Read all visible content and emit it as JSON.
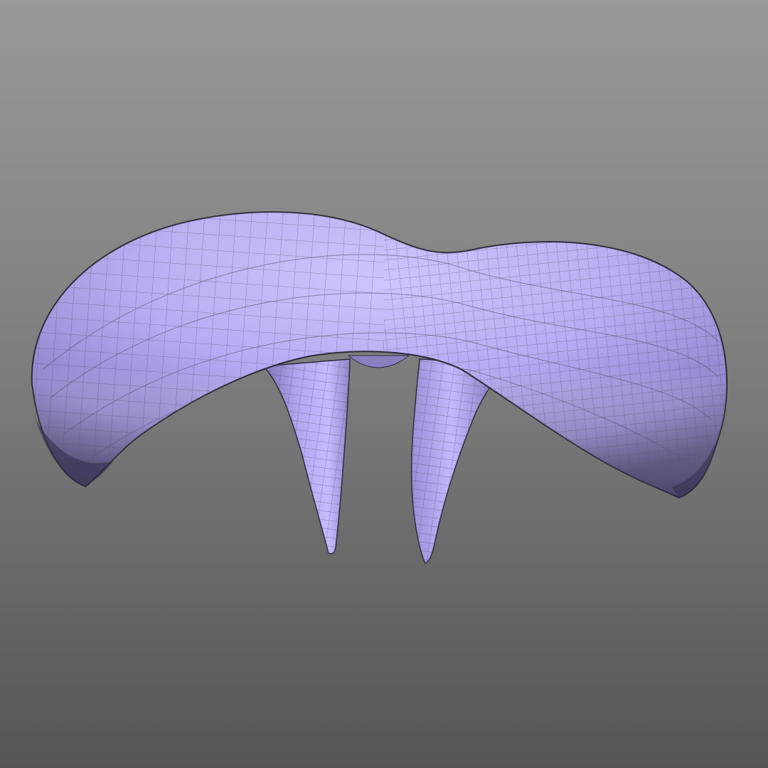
{
  "viewport": {
    "background_top": "#999999",
    "background_bottom": "#555555"
  },
  "model": {
    "shape": "curved bar with two tapering prongs",
    "shading": "wireframe-on-shaded",
    "surface_color": "#b7abf5",
    "shadow_color": "#4a4272",
    "wire_color": "#5c5570"
  }
}
